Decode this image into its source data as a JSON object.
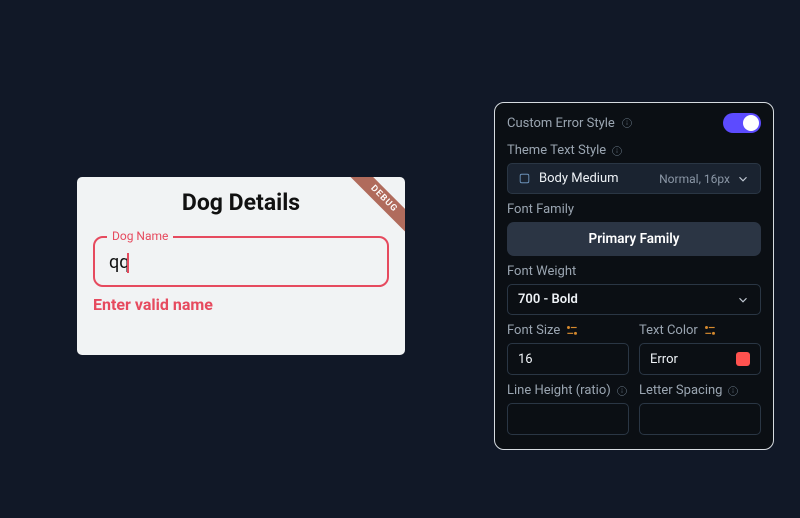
{
  "preview": {
    "title": "Dog Details",
    "debug_banner": "DEBUG",
    "input_label": "Dog Name",
    "input_value": "qq",
    "error_message": "Enter valid name"
  },
  "panel": {
    "custom_error_style": {
      "label": "Custom Error Style",
      "enabled": true
    },
    "theme_text_style": {
      "label": "Theme Text Style",
      "value": "Body Medium",
      "meta": "Normal, 16px"
    },
    "font_family": {
      "label": "Font Family",
      "value": "Primary Family"
    },
    "font_weight": {
      "label": "Font Weight",
      "value": "700 - Bold"
    },
    "font_size": {
      "label": "Font Size",
      "value": "16"
    },
    "text_color": {
      "label": "Text Color",
      "value": "Error",
      "swatch": "#ff524f"
    },
    "line_height": {
      "label": "Line Height (ratio)",
      "value": ""
    },
    "letter_spacing": {
      "label": "Letter Spacing",
      "value": ""
    }
  }
}
